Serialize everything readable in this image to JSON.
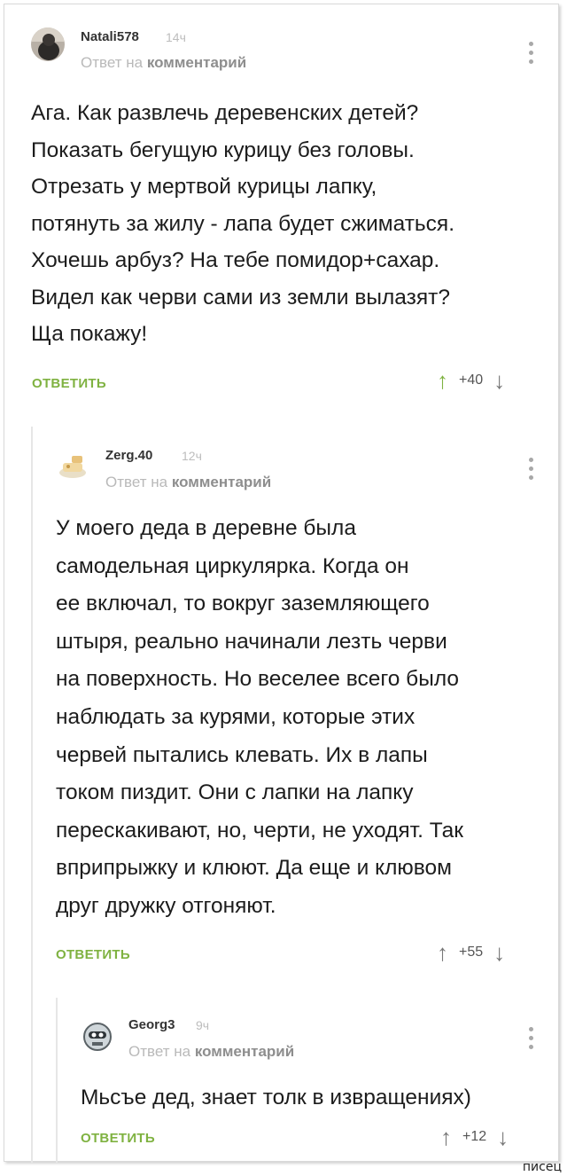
{
  "comments": [
    {
      "username": "Natali578",
      "time": "14ч",
      "reply_prefix": "Ответ на",
      "reply_target": "комментарий",
      "lines": [
        "Ага. Как развлечь деревенских детей?",
        "Показать бегущую курицу без головы.",
        "Отрезать у мертвой курицы лапку,",
        "потянуть за жилу - лапа будет сжиматься.",
        "Хочешь арбуз? На тебе помидор+сахар.",
        "Видел как черви сами из земли вылазят?",
        "Ща покажу!"
      ],
      "reply_label": "ОТВЕТИТЬ",
      "score": "+40",
      "upvoted": true
    },
    {
      "username": "Zerg.40",
      "time": "12ч",
      "reply_prefix": "Ответ на",
      "reply_target": "комментарий",
      "lines": [
        "У моего деда в деревне была",
        "самодельная циркулярка. Когда он",
        "ее включал, то вокруг заземляющего",
        "штыря, реально начинали лезть черви",
        "на поверхность. Но веселее всего было",
        "наблюдать за курями, которые этих",
        "червей пытались клевать. Их в лапы",
        "током пиздит. Они с лапки на лапку",
        "перескакивают, но, черти, не уходят. Так",
        "вприпрыжку и клюют. Да еще и клювом",
        "друг дружку отгоняют."
      ],
      "reply_label": "ОТВЕТИТЬ",
      "score": "+55",
      "upvoted": false
    },
    {
      "username": "Georg3",
      "time": "9ч",
      "reply_prefix": "Ответ на",
      "reply_target": "комментарий",
      "lines": [
        "Мьсъе дед, знает толк в извращениях)"
      ],
      "reply_label": "ОТВЕТИТЬ",
      "score": "+12",
      "upvoted": false
    }
  ],
  "icons": {
    "upvote": "arrow-up-icon",
    "downvote": "arrow-down-icon",
    "more": "more-dots-icon"
  },
  "colors": {
    "accent": "#7fb241",
    "muted": "#b9b9b9"
  },
  "watermark": "писец"
}
